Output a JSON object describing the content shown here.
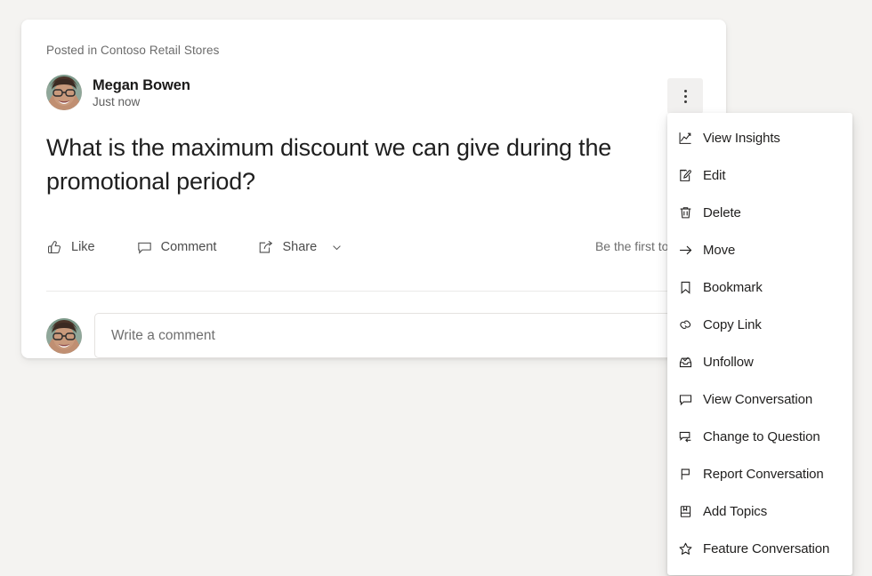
{
  "post": {
    "posted_in": "Posted in Contoso Retail Stores",
    "author_name": "Megan Bowen",
    "timestamp": "Just now",
    "body": "What is the maximum discount we can give during the promotional period?",
    "engagement_text": "Be the first to like this",
    "actions": [
      {
        "label": "Like",
        "icon": "thumbs-up-icon"
      },
      {
        "label": "Comment",
        "icon": "comment-bubble-icon"
      },
      {
        "label": "Share",
        "icon": "share-icon",
        "has_chevron": true
      }
    ]
  },
  "comment": {
    "placeholder": "Write a comment",
    "value": ""
  },
  "overflow_button": {
    "label": "More options",
    "icon": "more-vertical-icon"
  },
  "context_menu": {
    "items": [
      {
        "label": "View Insights",
        "icon": "line-chart-icon"
      },
      {
        "label": "Edit",
        "icon": "edit-pencil-icon"
      },
      {
        "label": "Delete",
        "icon": "trash-icon"
      },
      {
        "label": "Move",
        "icon": "arrow-right-icon"
      },
      {
        "label": "Bookmark",
        "icon": "bookmark-icon"
      },
      {
        "label": "Copy Link",
        "icon": "link-chain-icon"
      },
      {
        "label": "Unfollow",
        "icon": "inbox-check-icon"
      },
      {
        "label": "View Conversation",
        "icon": "speech-bubble-icon"
      },
      {
        "label": "Change to Question",
        "icon": "bubble-arrow-icon"
      },
      {
        "label": "Report Conversation",
        "icon": "flag-icon"
      },
      {
        "label": "Add Topics",
        "icon": "book-tag-icon"
      },
      {
        "label": "Feature Conversation",
        "icon": "star-icon"
      }
    ]
  },
  "colors": {
    "page_background": "#f4f3f1",
    "card_background": "#ffffff",
    "text_primary": "#1f1f1f",
    "text_secondary": "#6b6b6b",
    "menu_text": "#201f1e",
    "border": "#e4e2e0"
  }
}
